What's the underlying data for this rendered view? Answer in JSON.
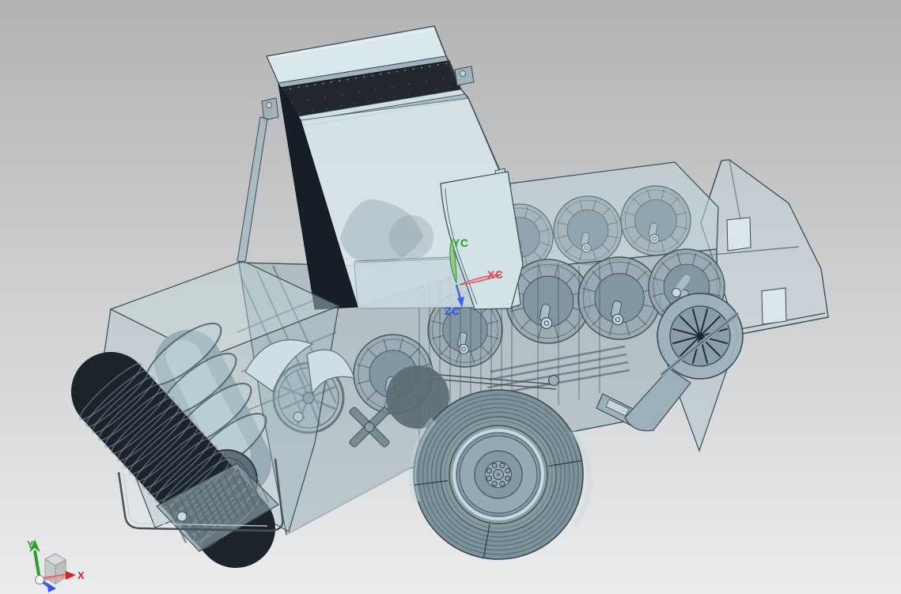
{
  "viewport": {
    "background_top": "#b1b3b5",
    "background_bottom": "#ebeced"
  },
  "wcs_triad": {
    "x_label": "XC",
    "y_label": "YC",
    "z_label": "ZC",
    "x_color": "#e04545",
    "y_color": "#1fa11f",
    "z_color": "#2b57f0"
  },
  "view_triad": {
    "x_label": "X",
    "y_label": "Y",
    "x_color": "#d42525",
    "y_color": "#2f9e2f",
    "z_color": "#2b57f0"
  },
  "model_colors": {
    "translucent_panel": "#bcd3da",
    "dark_grate_panel": "#23282e",
    "shadow_wall": "#161e28",
    "drum_metal": "#8ea3ad",
    "tire": "#7e929c",
    "edge_line": "#3d4a52"
  }
}
